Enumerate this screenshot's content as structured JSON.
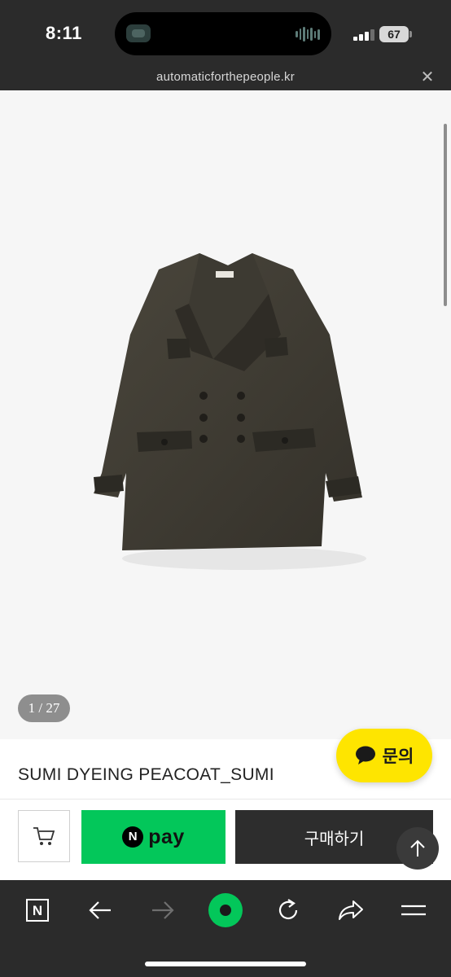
{
  "status_bar": {
    "time": "8:11",
    "battery": "67"
  },
  "browser": {
    "url": "automaticforthepeople.kr",
    "close_icon": "close-icon"
  },
  "product": {
    "image_counter": "1 / 27",
    "title": "SUMI DYEING PEACOAT_SUMI"
  },
  "inquiry": {
    "label": "문의",
    "color": "#fee500"
  },
  "buy_bar": {
    "npay_logo_letter": "N",
    "npay_label": "pay",
    "npay_color": "#03c75a",
    "buy_label": "구매하기"
  },
  "bottom_nav": {
    "home_label": "N",
    "items": [
      "naver-home-icon",
      "back-arrow-icon",
      "forward-arrow-icon",
      "green-dot-icon",
      "refresh-icon",
      "share-icon",
      "menu-icon"
    ]
  }
}
